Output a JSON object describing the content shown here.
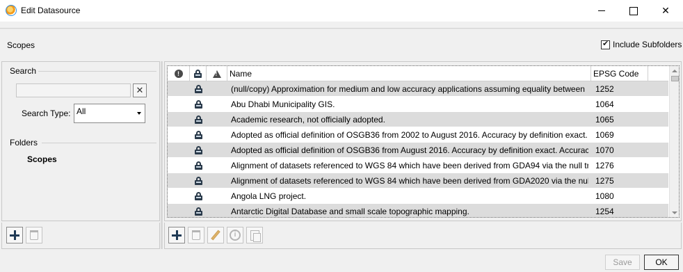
{
  "window": {
    "title": "Edit Datasource"
  },
  "header": {
    "scopes_label": "Scopes",
    "include_subfolders_label": "Include Subfolders",
    "include_subfolders_checked": true
  },
  "search": {
    "group_title": "Search",
    "value": "",
    "search_type_label": "Search Type:",
    "search_type_value": "All"
  },
  "folders": {
    "group_title": "Folders",
    "items": [
      "Scopes"
    ]
  },
  "grid": {
    "columns": {
      "name": "Name",
      "epsg": "EPSG Code"
    },
    "rows": [
      {
        "name": "(null/copy) Approximation for medium and low accuracy applications assuming equality between",
        "epsg": "1252"
      },
      {
        "name": "Abu Dhabi Municipality GIS.",
        "epsg": "1064"
      },
      {
        "name": "Academic research, not officially adopted.",
        "epsg": "1065"
      },
      {
        "name": "Adopted as official definition of OSGB36 from 2002 to August 2016. Accuracy by definition exact.",
        "epsg": "1069"
      },
      {
        "name": "Adopted as official definition of OSGB36 from August 2016. Accuracy by definition exact. Accurac",
        "epsg": "1070"
      },
      {
        "name": "Alignment of datasets referenced to WGS 84 which have been derived from GDA94 via the null tr",
        "epsg": "1276"
      },
      {
        "name": "Alignment of datasets referenced to WGS 84 which have been derived from GDA2020 via the nul",
        "epsg": "1275"
      },
      {
        "name": "Angola LNG project.",
        "epsg": "1080"
      },
      {
        "name": "Antarctic Digital Database and small scale topographic mapping.",
        "epsg": "1254"
      }
    ]
  },
  "footer": {
    "save_label": "Save",
    "ok_label": "OK"
  }
}
